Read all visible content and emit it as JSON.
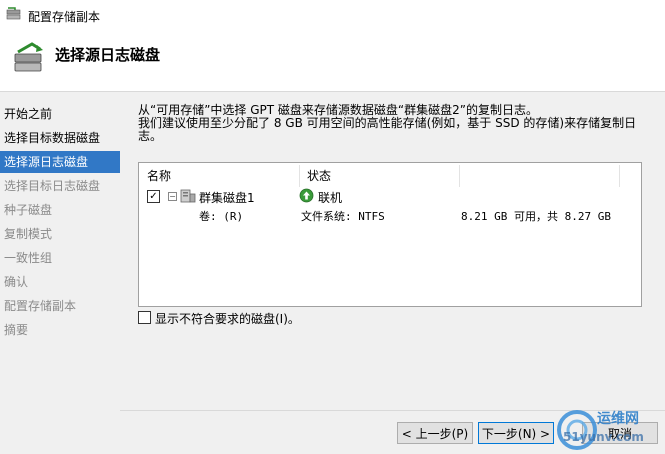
{
  "window": {
    "title": "配置存储副本"
  },
  "header": {
    "heading": "选择源日志磁盘"
  },
  "sidebar": {
    "items": [
      {
        "label": "开始之前",
        "state": "done"
      },
      {
        "label": "选择目标数据磁盘",
        "state": "done"
      },
      {
        "label": "选择源日志磁盘",
        "state": "active"
      },
      {
        "label": "选择目标日志磁盘",
        "state": "todo"
      },
      {
        "label": "种子磁盘",
        "state": "todo"
      },
      {
        "label": "复制模式",
        "state": "todo"
      },
      {
        "label": "一致性组",
        "state": "todo"
      },
      {
        "label": "确认",
        "state": "todo"
      },
      {
        "label": "配置存储副本",
        "state": "todo"
      },
      {
        "label": "摘要",
        "state": "todo"
      }
    ]
  },
  "main": {
    "description_line1": "从“可用存储”中选择 GPT 磁盘来存储源数据磁盘“群集磁盘2”的复制日志。",
    "description_line2": "我们建议使用至少分配了 8 GB 可用空间的高性能存储(例如，基于 SSD 的存储)来存储复制日",
    "description_line3": "志。",
    "table": {
      "columns": [
        "名称",
        "状态"
      ],
      "rows": [
        {
          "checked": true,
          "name": "群集磁盘1",
          "status": "联机",
          "volume": "卷: (R)",
          "filesystem": "文件系统: NTFS",
          "capacity": "8.21 GB 可用，共 8.27 GB"
        }
      ]
    },
    "show_incompatible_label": "显示不符合要求的磁盘(I)。"
  },
  "buttons": {
    "prev": "< 上一步(P)",
    "next": "下一步(N) >",
    "cancel": "取消"
  },
  "watermark": {
    "brand": "运维网",
    "site": "51yunv.com"
  },
  "colors": {
    "accent": "#3178c6",
    "online": "#3a9b3a"
  }
}
